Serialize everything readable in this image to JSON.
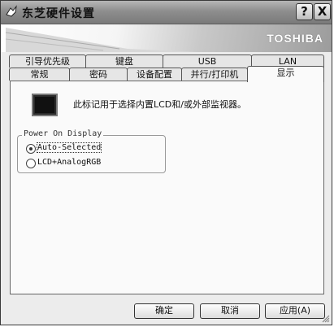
{
  "window": {
    "title": "东芝硬件设置",
    "help_label": "?",
    "close_label": "X",
    "brand": "TOSHIBA"
  },
  "tabs_back": [
    "引导优先级",
    "键盘",
    "USB",
    "LAN"
  ],
  "tabs_front": [
    "常规",
    "密码",
    "设备配置",
    "并行/打印机",
    "显示"
  ],
  "panel": {
    "description": "此标记用于选择内置LCD和/或外部监视器。",
    "group_label": "Power On Display",
    "options": [
      "Auto-Selected",
      "LCD+AnalogRGB"
    ],
    "selected_option": "Auto-Selected"
  },
  "buttons": {
    "ok": "确定",
    "cancel": "取消",
    "apply": "应用(A)"
  },
  "colors": {
    "titlebar": "#8e8e8e",
    "panel": "#fafafa",
    "window": "#ececec"
  }
}
